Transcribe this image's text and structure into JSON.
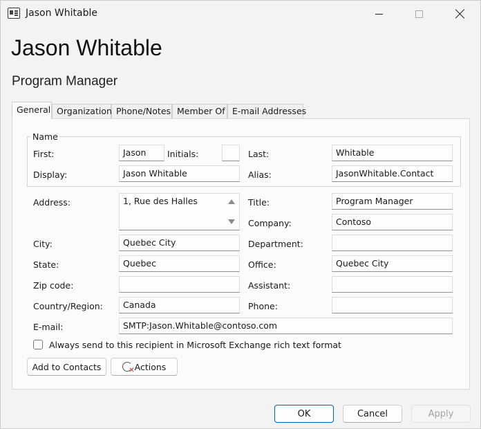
{
  "window": {
    "title": "Jason Whitable",
    "icon": "contact-card-icon",
    "controls": [
      "minimize-icon",
      "maximize-icon",
      "close-icon"
    ]
  },
  "header": {
    "display_name": "Jason Whitable",
    "job_title": "Program Manager"
  },
  "tabs": [
    {
      "label": "General",
      "active": true
    },
    {
      "label": "Organization",
      "active": false
    },
    {
      "label": "Phone/Notes",
      "active": false
    },
    {
      "label": "Member Of",
      "active": false
    },
    {
      "label": "E-mail Addresses",
      "active": false
    }
  ],
  "name_group": {
    "legend": "Name",
    "first_label": "First:",
    "first_value": "Jason",
    "initials_label": "Initials:",
    "initials_value": "",
    "last_label": "Last:",
    "last_value": "Whitable",
    "display_label": "Display:",
    "display_value": "Jason Whitable",
    "alias_label": "Alias:",
    "alias_value": "JasonWhitable.Contact"
  },
  "details": {
    "address_label": "Address:",
    "address_value": "1, Rue des Halles",
    "city_label": "City:",
    "city_value": "Quebec City",
    "state_label": "State:",
    "state_value": "Quebec",
    "zip_label": "Zip code:",
    "zip_value": "",
    "country_label": "Country/Region:",
    "country_value": "Canada",
    "title_label": "Title:",
    "title_value": "Program Manager",
    "company_label": "Company:",
    "company_value": "Contoso",
    "department_label": "Department:",
    "department_value": "",
    "office_label": "Office:",
    "office_value": "Quebec City",
    "assistant_label": "Assistant:",
    "assistant_value": "",
    "phone_label": "Phone:",
    "phone_value": "",
    "email_label": "E-mail:",
    "email_value": "SMTP:Jason.Whitable@contoso.com"
  },
  "rich_text_checkbox": {
    "label": "Always send to this recipient in Microsoft Exchange rich text format",
    "checked": false
  },
  "buttons": {
    "add_to_contacts": "Add to Contacts",
    "actions": "Actions",
    "ok": "OK",
    "cancel": "Cancel",
    "apply": "Apply"
  },
  "colors": {
    "accent": "#005fb8",
    "disabled_text": "#a3a3a3"
  }
}
